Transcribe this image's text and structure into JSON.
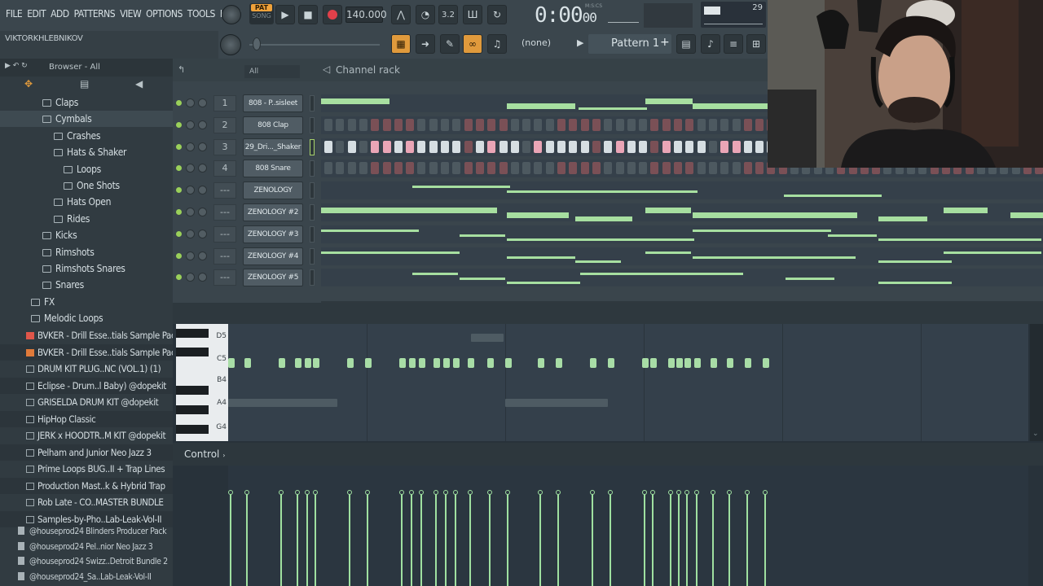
{
  "menu": [
    "FILE",
    "EDIT",
    "ADD",
    "PATTERNS",
    "VIEW",
    "OPTIONS",
    "TOOLS",
    "HELP"
  ],
  "transport": {
    "pat_label": "PAT",
    "song_label": "SONG",
    "tempo": "140.000",
    "time": "0:00",
    "time_frames": "00",
    "time_unit": "M:S:CS",
    "cpu": "29"
  },
  "hint": {
    "user": "VIKTORKHLEBNIKOV"
  },
  "toolbar": {
    "snap": "(none)",
    "pattern": "Pattern 1"
  },
  "browser": {
    "title": "Browser - All",
    "tree": [
      {
        "label": "Claps",
        "level": 1
      },
      {
        "label": "Cymbals",
        "level": 1
      },
      {
        "label": "Crashes",
        "level": 2
      },
      {
        "label": "Hats & Shaker",
        "level": 2
      },
      {
        "label": "Loops",
        "level": 3
      },
      {
        "label": "One Shots",
        "level": 3
      },
      {
        "label": "Hats Open",
        "level": 2
      },
      {
        "label": "Rides",
        "level": 2
      },
      {
        "label": "Kicks",
        "level": 1
      },
      {
        "label": "Rimshots",
        "level": 1
      },
      {
        "label": "Rimshots Snares",
        "level": 1
      },
      {
        "label": "Snares",
        "level": 1
      },
      {
        "label": "FX",
        "level": 0
      },
      {
        "label": "Melodic Loops",
        "level": 0
      }
    ],
    "packs": [
      {
        "label": "BVKER - Drill Esse..tials Sample Pack",
        "icon": "red"
      },
      {
        "label": "BVKER - Drill Esse..tials Sample Pack",
        "icon": "orange"
      },
      {
        "label": "DRUM KIT PLUG..NC (VOL.1) (1)",
        "icon": "folder"
      },
      {
        "label": "Eclipse - Drum..l Baby) @dopekit",
        "icon": "folder"
      },
      {
        "label": "GRISELDA DRUM KIT @dopekit",
        "icon": "folder"
      },
      {
        "label": "HipHop Classic",
        "icon": "folder"
      },
      {
        "label": "JERK x HOODTR..M KIT @dopekit",
        "icon": "folder"
      },
      {
        "label": "Pelham and Junior Neo Jazz 3",
        "icon": "folder"
      },
      {
        "label": "Prime Loops BUG..II + Trap Lines",
        "icon": "folder"
      },
      {
        "label": "Production Mast..k & Hybrid Trap",
        "icon": "folder"
      },
      {
        "label": "Rob Late - CO..MASTER BUNDLE",
        "icon": "folder"
      },
      {
        "label": "Samples-by-Pho..Lab-Leak-Vol-II",
        "icon": "folder"
      }
    ],
    "files": [
      {
        "label": "@houseprod24 Blinders Producer Pack"
      },
      {
        "label": "@houseprod24 Pel..nior Neo Jazz 3"
      },
      {
        "label": "@houseprod24 Swizz..Detroit Bundle 2"
      },
      {
        "label": "@houseprod24_Sa..Lab-Leak-Vol-II"
      }
    ]
  },
  "rack": {
    "title": "Channel rack",
    "filter": "All",
    "channels": [
      {
        "num": "1",
        "name": "808 - P..sisleet"
      },
      {
        "num": "2",
        "name": "808 Clap"
      },
      {
        "num": "3",
        "name": "29_Dri..._Shaker"
      },
      {
        "num": "4",
        "name": "808 Snare"
      },
      {
        "num": "---",
        "name": "ZENOLOGY"
      },
      {
        "num": "---",
        "name": "ZENOLOGY #2"
      },
      {
        "num": "---",
        "name": "ZENOLOGY #3"
      },
      {
        "num": "---",
        "name": "ZENOLOGY #4"
      },
      {
        "num": "---",
        "name": "ZENOLOGY #5"
      }
    ],
    "add": "+"
  },
  "piano_roll": {
    "keys": [
      "D5",
      "C5",
      "B4",
      "A4",
      "G4"
    ],
    "control": "Control"
  },
  "colors": {
    "note": "#a8dda6",
    "accent": "#f0a23a",
    "record": "#e0404a"
  }
}
